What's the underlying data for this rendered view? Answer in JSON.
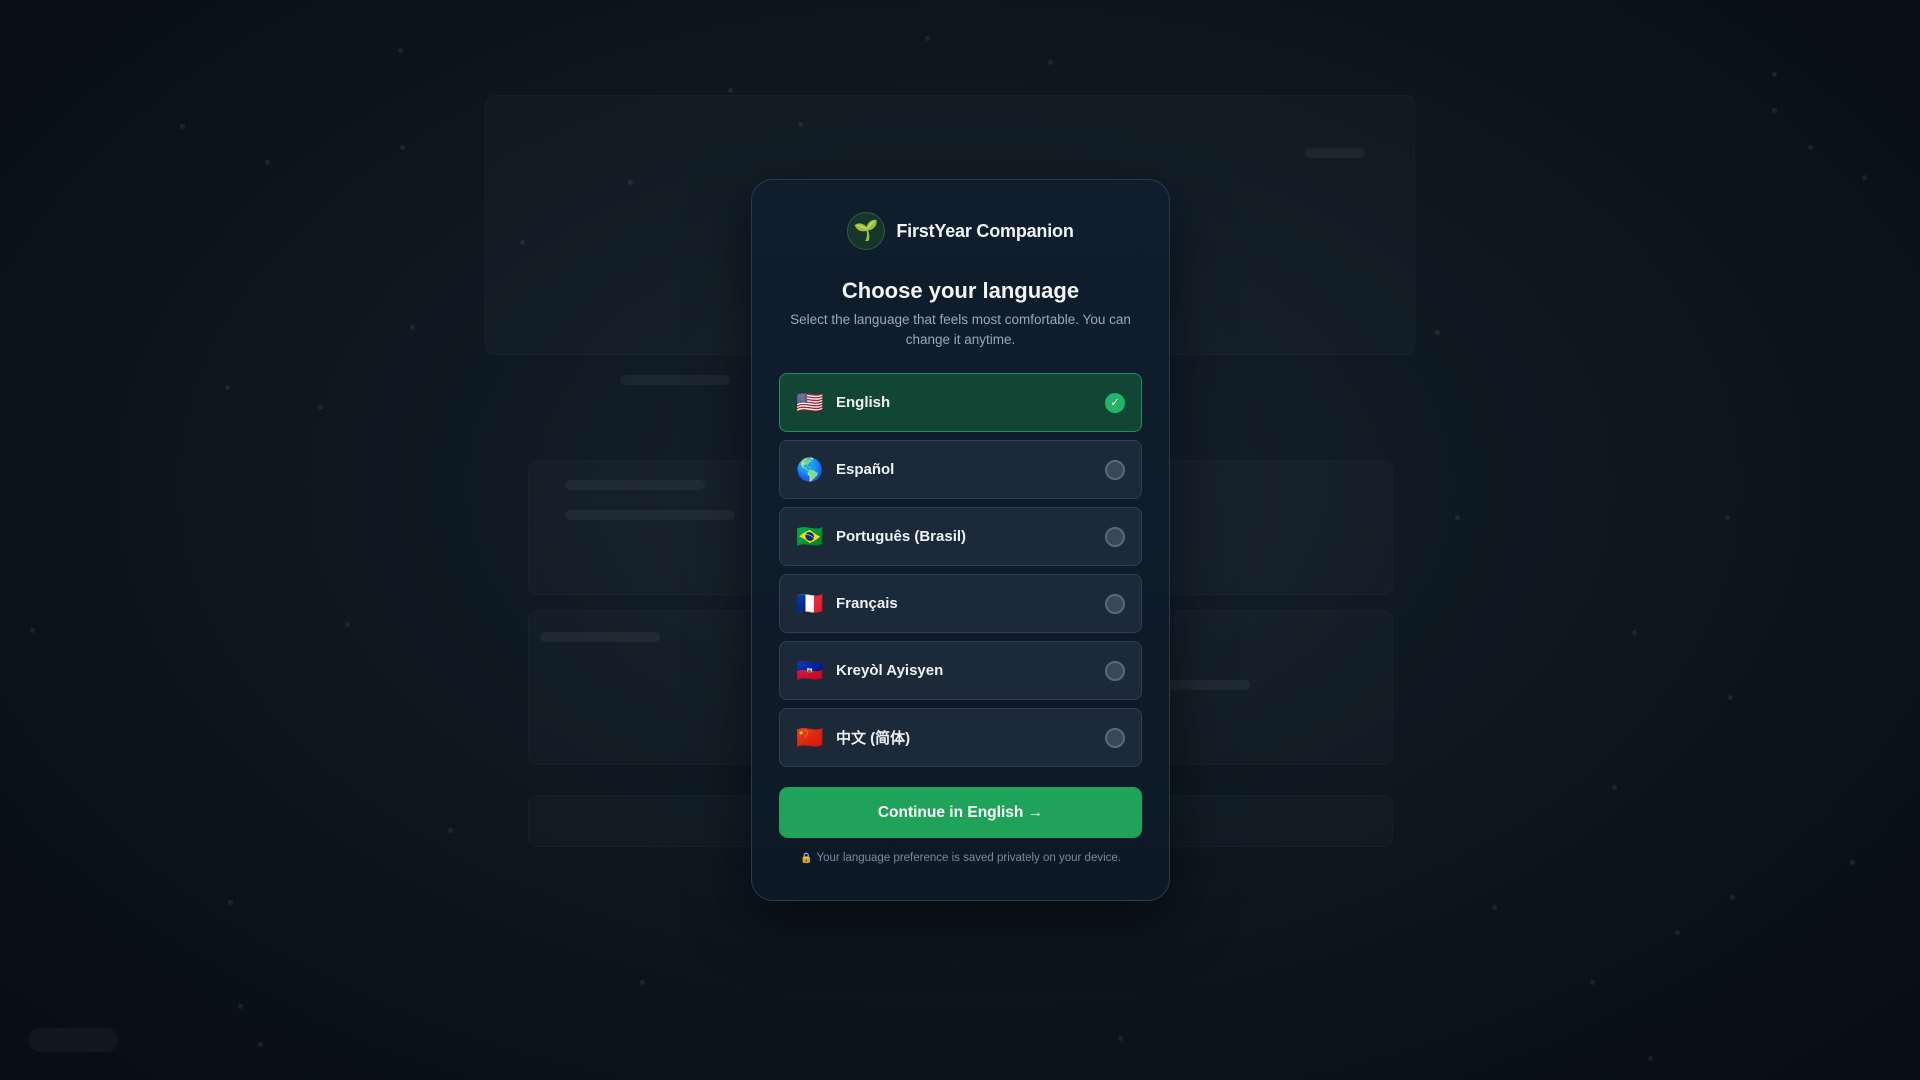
{
  "brand": {
    "logo_icon": "seedling-icon",
    "logo_glyph": "🌱",
    "name": "FirstYear Companion"
  },
  "dialog": {
    "title": "Choose your language",
    "subtitle": "Select the language that feels most comfortable. You can change it anytime."
  },
  "languages": [
    {
      "flag": "🇺🇸",
      "flag_icon": "us-flag-icon",
      "label": "English",
      "selected": true
    },
    {
      "flag": "🌎",
      "flag_icon": "globe-icon",
      "label": "Español",
      "selected": false
    },
    {
      "flag": "🇧🇷",
      "flag_icon": "brazil-flag-icon",
      "label": "Português (Brasil)",
      "selected": false
    },
    {
      "flag": "🇫🇷",
      "flag_icon": "france-flag-icon",
      "label": "Français",
      "selected": false
    },
    {
      "flag": "🇭🇹",
      "flag_icon": "haiti-flag-icon",
      "label": "Kreyòl Ayisyen",
      "selected": false
    },
    {
      "flag": "🇨🇳",
      "flag_icon": "china-flag-icon",
      "label": "中文 (简体)",
      "selected": false
    }
  ],
  "selected_check": "✓",
  "continue_button": {
    "label": "Continue in English →"
  },
  "privacy": {
    "lock_glyph": "🔒",
    "text": "Your language preference is saved privately on your device."
  },
  "colors": {
    "accent": "#1fa35a",
    "selected_bg": "#114534",
    "modal_bg": "#0f1d2d",
    "page_bg": "#0b141c"
  }
}
